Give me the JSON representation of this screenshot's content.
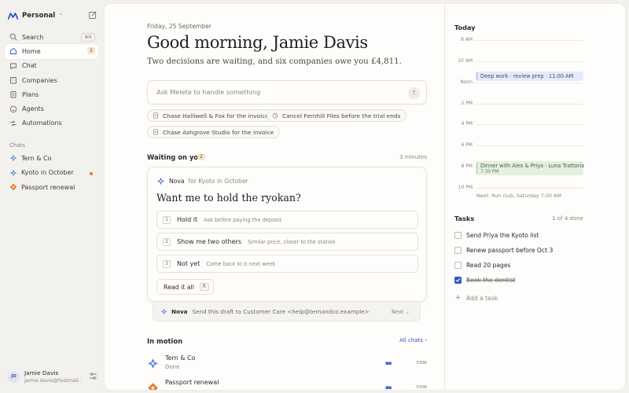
{
  "sidebar": {
    "workspace": "Personal",
    "search_shortcut": "⌘K",
    "nav": [
      {
        "label": "Search",
        "icon": "search-icon"
      },
      {
        "label": "Home",
        "icon": "home-icon",
        "badge": "2"
      },
      {
        "label": "Chat",
        "icon": "chat-icon"
      },
      {
        "label": "Companies",
        "icon": "building-icon"
      },
      {
        "label": "Plans",
        "icon": "clipboard-icon"
      },
      {
        "label": "Agents",
        "icon": "smiley-icon"
      },
      {
        "label": "Automations",
        "icon": "automation-icon"
      }
    ],
    "chats_heading": "Chats",
    "chats": [
      {
        "label": "Tern & Co"
      },
      {
        "label": "Kyoto in October"
      },
      {
        "label": "Passport renewal"
      }
    ],
    "user": {
      "initials": "JD",
      "name": "Jamie Davis",
      "email": "jamie.davis@fastmail..."
    }
  },
  "home": {
    "date": "Friday, 25 September",
    "greeting": "Good morning, Jamie Davis",
    "subtitle": "Two decisions are waiting, and six companies owe you £4,811.",
    "ask_placeholder": "Ask Melete to handle something",
    "suggestions": [
      "Chase Halliwell & Fox for the invoice",
      "Cancel Fernhill Files before the trial ends",
      "Chase Ashgrove Studio for the invoice"
    ],
    "waiting": {
      "title": "Waiting on you",
      "count": "2",
      "time": "3 minutes",
      "card": {
        "agent": "Nova",
        "context": "for Kyoto in October",
        "question": "Want me to hold the ryokan?",
        "options": [
          {
            "num": "1",
            "label": "Hold it",
            "desc": "Ask before paying the deposit"
          },
          {
            "num": "2",
            "label": "Show me two others",
            "desc": "Similar price, closer to the station"
          },
          {
            "num": "3",
            "label": "Not yet",
            "desc": "Come back to it next week"
          }
        ],
        "read_label": "Read it all",
        "read_key": "R"
      },
      "draft": {
        "agent": "Nova",
        "text": "Send this draft to Customer Care <help@ternandco.example>",
        "next": "Next ⌄"
      }
    },
    "motion": {
      "title": "In motion",
      "link": "All chats",
      "items": [
        {
          "title": "Tern & Co",
          "status": "Done",
          "time": "now"
        },
        {
          "title": "Passport renewal",
          "status": "",
          "time": "now"
        }
      ]
    }
  },
  "today": {
    "title": "Today",
    "hours": [
      "8 AM",
      "10 AM",
      "Noon",
      "2 PM",
      "4 PM",
      "6 PM",
      "8 PM",
      "10 PM"
    ],
    "events": [
      {
        "title": "Deep work · review prep · 11:00 AM"
      },
      {
        "title": "Dinner with Alex & Priya · Luna Trattoria",
        "time": "7:30 PM"
      }
    ],
    "next": "Next: Run club, Saturday 7:00 AM"
  },
  "tasks": {
    "title": "Tasks",
    "progress": "1 of 4 done",
    "items": [
      {
        "label": "Send Priya the Kyoto list",
        "done": false
      },
      {
        "label": "Renew passport before Oct 3",
        "done": false
      },
      {
        "label": "Read 20 pages",
        "done": false
      },
      {
        "label": "Book the dentist",
        "done": true
      }
    ],
    "add_label": "Add a task"
  },
  "colors": {
    "accent": "#3457c5",
    "unread": "#e07b2f",
    "badge": "#f2e5c9"
  }
}
